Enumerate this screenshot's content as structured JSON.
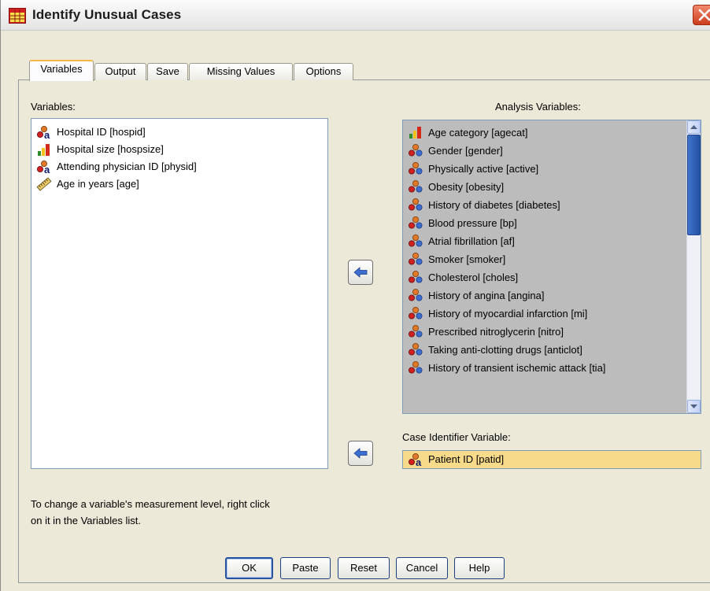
{
  "window": {
    "title": "Identify Unusual Cases",
    "close_glyph": "✕"
  },
  "tabs": [
    {
      "label": "Variables",
      "active": true
    },
    {
      "label": "Output",
      "active": false
    },
    {
      "label": "Save",
      "active": false
    },
    {
      "label": "Missing Values",
      "active": false
    },
    {
      "label": "Options",
      "active": false
    }
  ],
  "variables": {
    "label": "Variables:",
    "items": [
      {
        "label": "Hospital ID [hospid]",
        "icon": "nominal-string-icon"
      },
      {
        "label": "Hospital size [hospsize]",
        "icon": "ordinal-icon"
      },
      {
        "label": "Attending physician ID [physid]",
        "icon": "nominal-string-icon"
      },
      {
        "label": "Age in years [age]",
        "icon": "scale-ruler-icon"
      }
    ]
  },
  "analysis": {
    "label": "Analysis Variables:",
    "items": [
      {
        "label": "Age category [agecat]",
        "icon": "ordinal-icon"
      },
      {
        "label": "Gender [gender]",
        "icon": "nominal-icon"
      },
      {
        "label": "Physically active [active]",
        "icon": "nominal-icon"
      },
      {
        "label": "Obesity [obesity]",
        "icon": "nominal-icon"
      },
      {
        "label": "History of diabetes [diabetes]",
        "icon": "nominal-icon"
      },
      {
        "label": "Blood pressure [bp]",
        "icon": "nominal-icon"
      },
      {
        "label": "Atrial fibrillation [af]",
        "icon": "nominal-icon"
      },
      {
        "label": "Smoker [smoker]",
        "icon": "nominal-icon"
      },
      {
        "label": "Cholesterol [choles]",
        "icon": "nominal-icon"
      },
      {
        "label": "History of angina [angina]",
        "icon": "nominal-icon"
      },
      {
        "label": "History of myocardial infarction [mi]",
        "icon": "nominal-icon"
      },
      {
        "label": "Prescribed nitroglycerin [nitro]",
        "icon": "nominal-icon"
      },
      {
        "label": "Taking anti-clotting drugs [anticlot]",
        "icon": "nominal-icon"
      },
      {
        "label": "History of transient ischemic attack [tia]",
        "icon": "nominal-icon"
      }
    ]
  },
  "case_identifier": {
    "label": "Case Identifier Variable:",
    "value": "Patient ID [patid]",
    "icon": "nominal-string-icon"
  },
  "note": {
    "line1": "To change a variable's measurement level, right click",
    "line2": "on it in the Variables list."
  },
  "buttons": {
    "ok": "OK",
    "paste": "Paste",
    "reset": "Reset",
    "cancel": "Cancel",
    "help": "Help"
  },
  "colors": {
    "dialog_bg": "#ece9d8",
    "analysis_list_bg": "#bcbcbc",
    "case_highlight": "#f7da8a",
    "active_tab_accent": "#f3b74a",
    "scroll_thumb": "#2f5fb5"
  }
}
